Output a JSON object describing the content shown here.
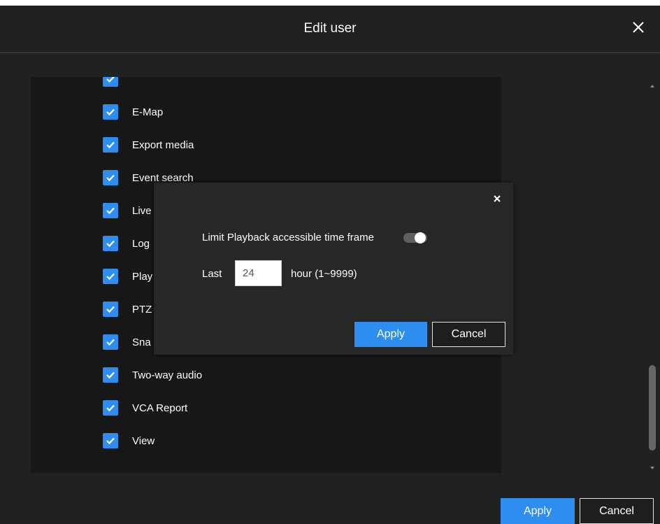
{
  "dialog": {
    "title": "Edit user"
  },
  "permissions": [
    {
      "label": "",
      "checked": true
    },
    {
      "label": "E-Map",
      "checked": true
    },
    {
      "label": "Export media",
      "checked": true
    },
    {
      "label": "Event search",
      "checked": true
    },
    {
      "label": "Live",
      "checked": true
    },
    {
      "label": "Log",
      "checked": true
    },
    {
      "label": "Play",
      "checked": true
    },
    {
      "label": "PTZ",
      "checked": true
    },
    {
      "label": "Sna",
      "checked": true
    },
    {
      "label": "Two-way audio",
      "checked": true
    },
    {
      "label": "VCA Report",
      "checked": true
    },
    {
      "label": "View",
      "checked": true
    }
  ],
  "playback_popup": {
    "limit_label": "Limit Playback accessible time frame",
    "limit_enabled": false,
    "last_label": "Last",
    "hours_value": "24",
    "hours_range": "hour (1~9999)",
    "apply_label": "Apply",
    "cancel_label": "Cancel"
  },
  "footer": {
    "apply_label": "Apply",
    "cancel_label": "Cancel"
  },
  "colors": {
    "accent": "#2e8ef0",
    "background": "#212121",
    "panel": "#171717"
  }
}
